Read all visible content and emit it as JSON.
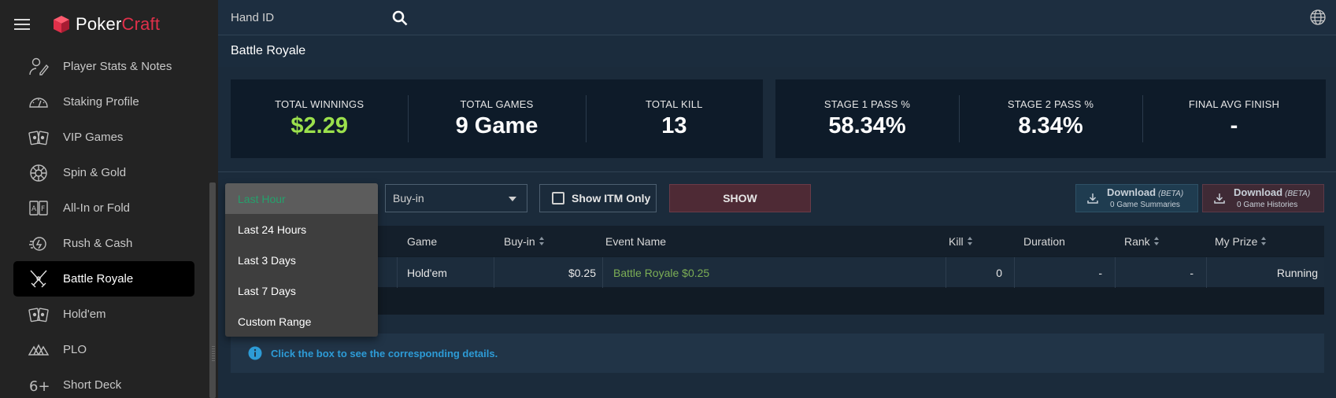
{
  "app": {
    "logo_part1": "Poker",
    "logo_part2": "Craft",
    "brand_color": "#e0304a"
  },
  "sidebar": {
    "items": [
      {
        "label": "Player Stats & Notes",
        "icon": "player-stats-icon"
      },
      {
        "label": "Staking Profile",
        "icon": "gauge-icon"
      },
      {
        "label": "VIP Games",
        "icon": "cards-icon"
      },
      {
        "label": "Spin & Gold",
        "icon": "spin-icon"
      },
      {
        "label": "All-In or Fold",
        "icon": "all-in-icon"
      },
      {
        "label": "Rush & Cash",
        "icon": "rush-icon"
      },
      {
        "label": "Battle Royale",
        "icon": "crossed-swords-icon",
        "active": true
      },
      {
        "label": "Hold'em",
        "icon": "holdem-cards-icon"
      },
      {
        "label": "PLO",
        "icon": "plo-cards-icon"
      },
      {
        "label": "Short Deck",
        "icon": "six-plus-icon"
      }
    ]
  },
  "topbar": {
    "hand_id_label": "Hand ID"
  },
  "page": {
    "title": "Battle Royale"
  },
  "stats": {
    "panel1": [
      {
        "caption": "TOTAL WINNINGS",
        "value": "$2.29"
      },
      {
        "caption": "TOTAL GAMES",
        "value": "9 Game"
      },
      {
        "caption": "TOTAL KILL",
        "value": "13"
      }
    ],
    "panel2": [
      {
        "caption": "STAGE 1 PASS %",
        "value": "58.34%"
      },
      {
        "caption": "STAGE 2 PASS %",
        "value": "8.34%"
      },
      {
        "caption": "FINAL AVG FINISH",
        "value": "-"
      }
    ]
  },
  "filters": {
    "buyin_select": "Buy-in",
    "show_itm_label": "Show ITM Only",
    "show_button": "SHOW",
    "download_summaries": {
      "title": "Download",
      "beta": "(BETA)",
      "sub": "0 Game Summaries"
    },
    "download_histories": {
      "title": "Download",
      "beta": "(BETA)",
      "sub": "0 Game Histories"
    }
  },
  "time_dropdown": {
    "options": [
      "Last Hour",
      "Last 24 Hours",
      "Last 3 Days",
      "Last 7 Days",
      "Custom Range"
    ],
    "selected": "Last Hour"
  },
  "table": {
    "headers": {
      "game": "Game",
      "buyin": "Buy-in",
      "event": "Event Name",
      "kill": "Kill",
      "duration": "Duration",
      "rank": "Rank",
      "prize": "My Prize"
    },
    "rows": [
      {
        "game": "Hold'em",
        "buyin": "$0.25",
        "event": "Battle Royale $0.25",
        "kill": "0",
        "duration": "-",
        "rank": "-",
        "prize": "Running"
      }
    ]
  },
  "info": {
    "text": "Click the box to see the corresponding details."
  }
}
